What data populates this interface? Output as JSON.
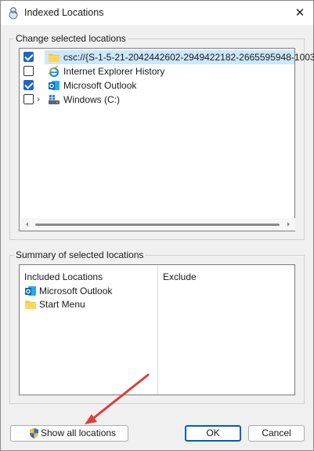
{
  "window": {
    "title": "Indexed Locations",
    "close_glyph": "✕"
  },
  "change_group": {
    "label": "Change selected locations",
    "items": [
      {
        "label": "csc://{S-1-5-21-2042442602-2949422182-2665595948-1003",
        "checked": true,
        "selected": true,
        "expandable": false,
        "icon": "folder-icon"
      },
      {
        "label": "Internet Explorer History",
        "checked": false,
        "selected": false,
        "expandable": false,
        "icon": "internet-explorer-icon"
      },
      {
        "label": "Microsoft Outlook",
        "checked": true,
        "selected": false,
        "expandable": false,
        "icon": "outlook-icon"
      },
      {
        "label": "Windows (C:)",
        "checked": false,
        "selected": false,
        "expandable": true,
        "icon": "drive-icon"
      }
    ]
  },
  "summary_group": {
    "label": "Summary of selected locations",
    "included_header": "Included Locations",
    "exclude_header": "Exclude",
    "included": [
      {
        "label": "Microsoft Outlook",
        "icon": "outlook-icon"
      },
      {
        "label": "Start Menu",
        "icon": "folder-icon"
      }
    ]
  },
  "buttons": {
    "show_all": "Show all locations",
    "ok": "OK",
    "cancel": "Cancel"
  },
  "annotation": {
    "arrow_color": "#d9403a"
  }
}
